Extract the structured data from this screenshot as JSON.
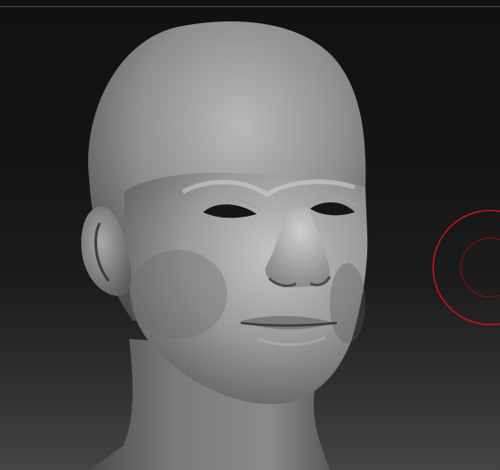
{
  "app": {
    "type": "3d-sculpting-viewport",
    "canvas_background": {
      "top": "#111111",
      "bottom": "#444444"
    },
    "model": {
      "subject": "male-head-sculpt",
      "material_color": "#8f8f8f",
      "eye_color": "#151515"
    },
    "brush_cursor": {
      "outer_ring_color": "#c81414",
      "inner_ring_color": "#7a0f0f"
    }
  }
}
